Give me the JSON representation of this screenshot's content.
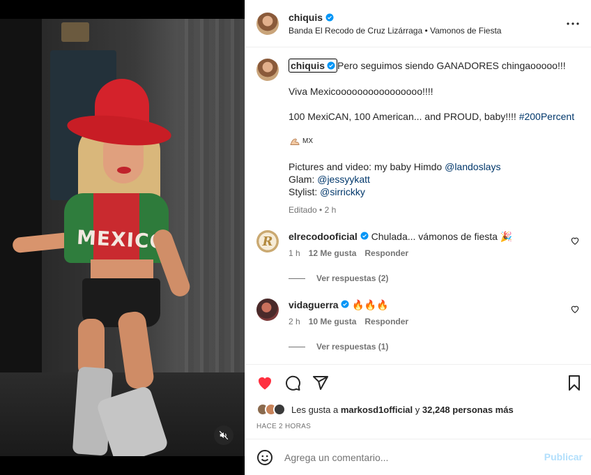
{
  "post": {
    "username": "chiquis",
    "audio": "Banda El Recodo de Cruz Lizárraga • Vamonos de Fiesta"
  },
  "caption": {
    "username": "chiquis",
    "line1": "Pero seguimos siendo GANADORES chingaooooo!!!",
    "line2": "Viva Mexicoooooooooooooooo!!!!",
    "line3_text": "100 MexiCAN, 100 American... and PROUD, baby!!!! ",
    "line3_tag": "#200Percent",
    "line4_flag": "MX",
    "credits1_text": "Pictures and video: my baby Himdo ",
    "credits1_link": "@landoslays",
    "credits2_text": "Glam: ",
    "credits2_link": "@jessyykatt",
    "credits3_text": "Stylist: ",
    "credits3_link": "@sirrickky",
    "meta": "Editado • 2 h"
  },
  "comments": [
    {
      "username": "elrecodooficial",
      "text": "Chulada... vámonos de fiesta 🎉",
      "time": "1 h",
      "likes": "12 Me gusta",
      "reply": "Responder",
      "view_replies": "Ver respuestas (2)"
    },
    {
      "username": "vidaguerra",
      "text": "🔥🔥🔥",
      "time": "2 h",
      "likes": "10 Me gusta",
      "reply": "Responder",
      "view_replies": "Ver respuestas (1)"
    }
  ],
  "likes": {
    "prefix": "Les gusta a ",
    "user": "markosd1official",
    "middle": " y ",
    "count": "32,248 personas más"
  },
  "time_ago": "HACE 2 HORAS",
  "add_comment": {
    "placeholder": "Agrega un comentario...",
    "publish": "Publicar"
  },
  "icons": {
    "like": "heart-filled-icon",
    "comment": "comment-icon",
    "share": "share-icon",
    "save": "bookmark-icon",
    "emoji": "emoji-icon",
    "mute": "mute-icon",
    "more": "more-options-icon",
    "verified": "verified-badge-icon"
  },
  "colors": {
    "like_red": "#ff3040",
    "verified_blue": "#0095f6",
    "link_blue": "#00376b",
    "publish_disabled": "#b2dffc"
  }
}
